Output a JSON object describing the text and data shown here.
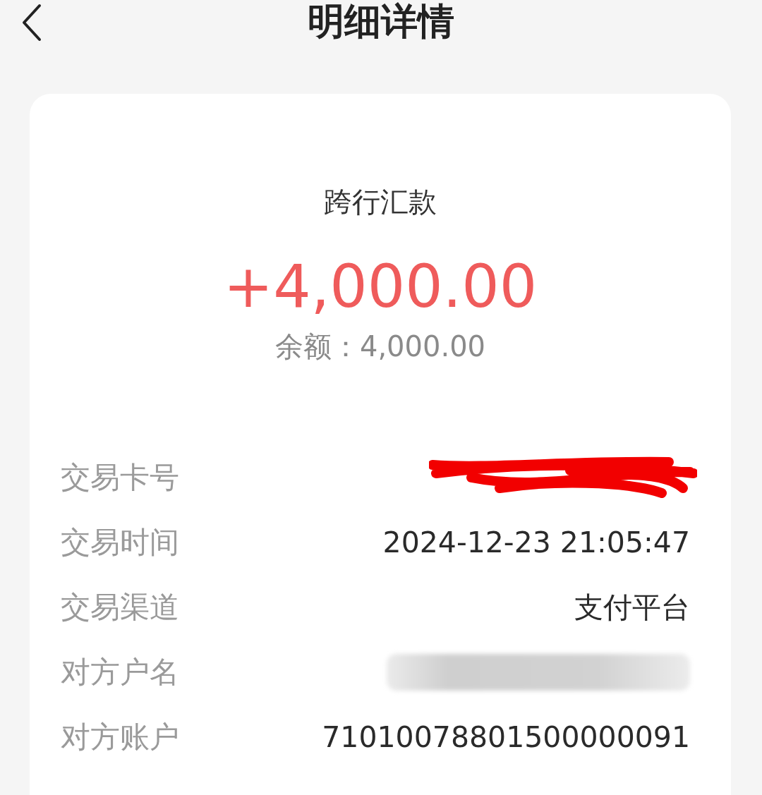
{
  "header": {
    "title": "明细详情"
  },
  "summary": {
    "type": "跨行汇款",
    "amount": "+4,000.00",
    "balance_label": "余额：",
    "balance": "4,000.00"
  },
  "details": [
    {
      "label": "交易卡号",
      "kind": "redacted"
    },
    {
      "label": "交易时间",
      "kind": "text",
      "value": "2024-12-23 21:05:47"
    },
    {
      "label": "交易渠道",
      "kind": "text",
      "value": "支付平台"
    },
    {
      "label": "对方户名",
      "kind": "blurred"
    },
    {
      "label": "对方账户",
      "kind": "text",
      "value": "71010078801500000091"
    }
  ]
}
